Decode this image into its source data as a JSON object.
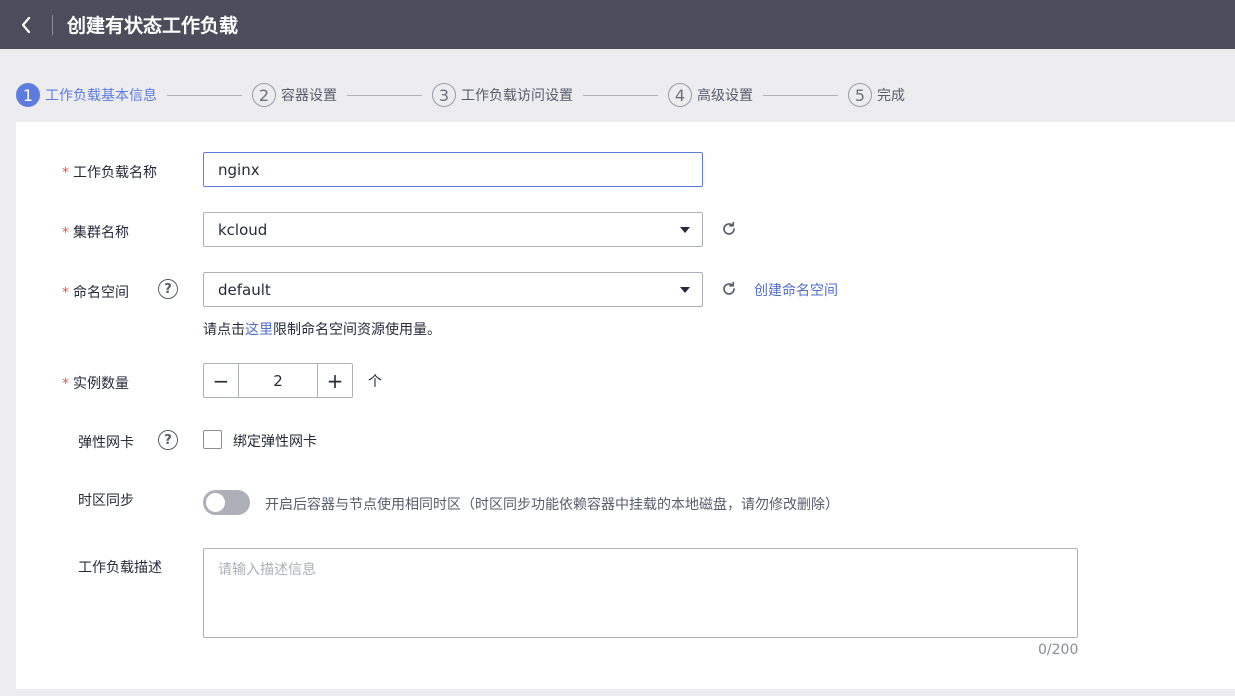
{
  "header": {
    "title": "创建有状态工作负载"
  },
  "steps": [
    {
      "num": "1",
      "label": "工作负载基本信息"
    },
    {
      "num": "2",
      "label": "容器设置"
    },
    {
      "num": "3",
      "label": "工作负载访问设置"
    },
    {
      "num": "4",
      "label": "高级设置"
    },
    {
      "num": "5",
      "label": "完成"
    }
  ],
  "form": {
    "required_mark": "*",
    "workload_name": {
      "label": "工作负载名称",
      "value": "nginx"
    },
    "cluster": {
      "label": "集群名称",
      "value": "kcloud"
    },
    "namespace": {
      "label": "命名空间",
      "value": "default",
      "create_link": "创建命名空间",
      "hint_prefix": "请点击",
      "hint_link": "这里",
      "hint_suffix": "限制命名空间资源使用量。"
    },
    "instances": {
      "label": "实例数量",
      "minus": "−",
      "value": "2",
      "plus": "+",
      "unit": "个"
    },
    "eni": {
      "label": "弹性网卡",
      "checkbox_label": "绑定弹性网卡",
      "checked": false
    },
    "timezone": {
      "label": "时区同步",
      "description": "开启后容器与节点使用相同时区（时区同步功能依赖容器中挂载的本地磁盘，请勿修改删除）",
      "enabled": false
    },
    "description": {
      "label": "工作负载描述",
      "placeholder": "请输入描述信息",
      "counter": "0/200"
    }
  },
  "colors": {
    "accent": "#5e7ce0",
    "link": "#526ecc",
    "required": "#e5574e",
    "topbar": "#4b4e5a"
  },
  "icons": {
    "help": "?",
    "back": "chevron-left-icon",
    "refresh": "refresh-icon"
  }
}
